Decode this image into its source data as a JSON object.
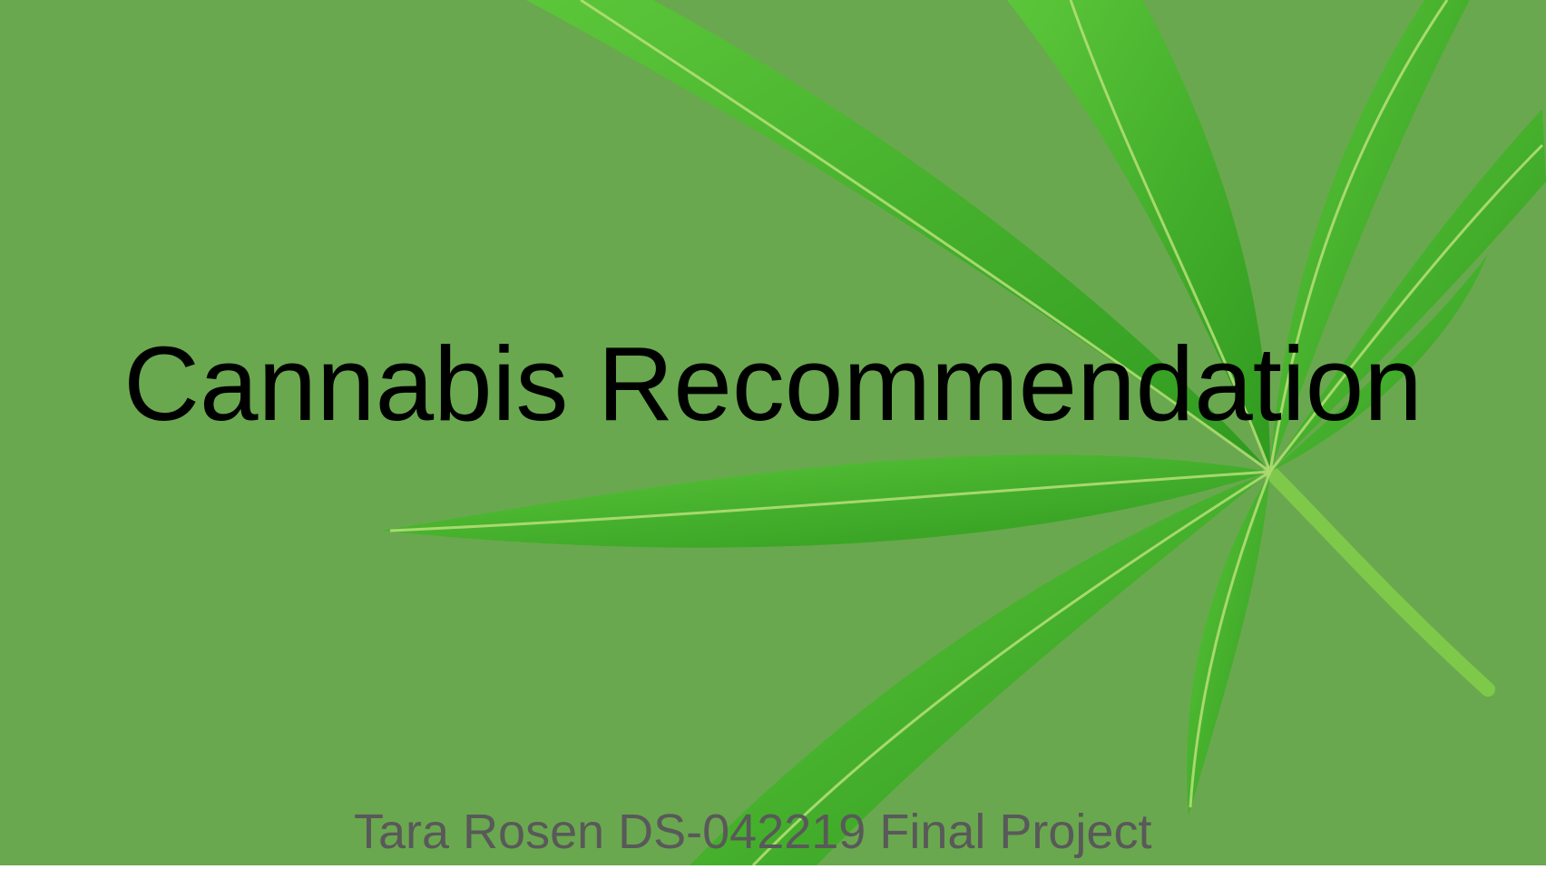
{
  "slide": {
    "title": "Cannabis Recommendation",
    "subtitle": "Tara Rosen DS-042219 Final Project",
    "background_color": "#6aa84f",
    "leaf_color": "#3fae2a",
    "leaf_vein_color": "#b9e07a",
    "icon": "cannabis-leaf-image"
  }
}
